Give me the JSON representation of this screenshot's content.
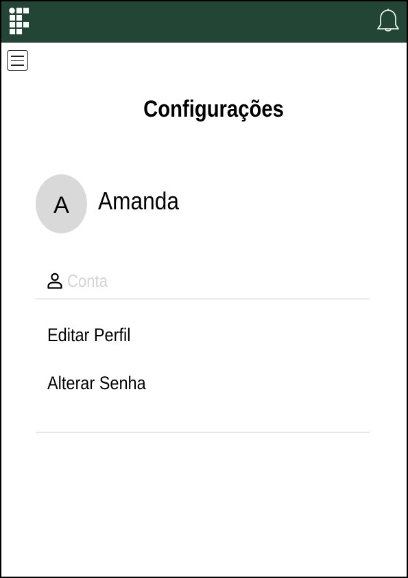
{
  "app": {
    "logo_icon": "ifsp-logo-icon",
    "brand_color": "#224535",
    "notification_icon": "bell-icon",
    "menu_icon": "hamburger-menu-icon"
  },
  "page": {
    "title": "Configurações"
  },
  "profile": {
    "initial": "A",
    "name": "Amanda",
    "avatar_color": "#d9d9d9"
  },
  "account_section": {
    "icon": "person-icon",
    "label": "Conta",
    "items": [
      {
        "label": "Editar Perfil"
      },
      {
        "label": "Alterar Senha"
      }
    ]
  }
}
